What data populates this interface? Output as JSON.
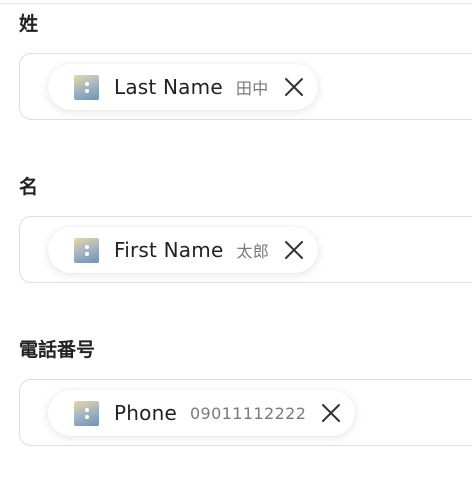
{
  "fields": [
    {
      "label": "姓",
      "token": {
        "name": "Last Name",
        "value": "田中",
        "icon": "variable-field-icon"
      }
    },
    {
      "label": "名",
      "token": {
        "name": "First Name",
        "value": "太郎",
        "icon": "variable-field-icon"
      }
    },
    {
      "label": "電話番号",
      "token": {
        "name": "Phone",
        "value": "09011112222",
        "icon": "variable-field-icon"
      }
    }
  ],
  "colors": {
    "label": "#222222",
    "border": "#dedede",
    "value": "#7a7a7a",
    "icon_gradient": [
      "#e9d8a0",
      "#a9b8c2",
      "#6b93b8"
    ]
  }
}
